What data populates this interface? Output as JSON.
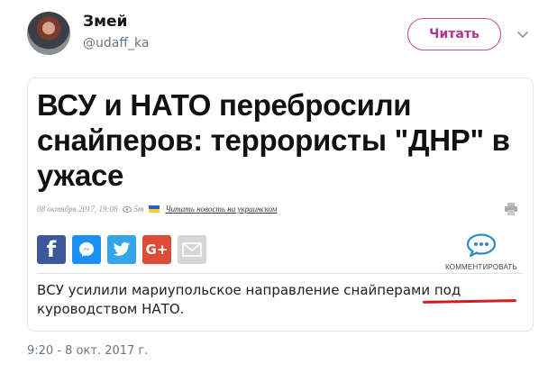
{
  "tweet": {
    "author_name": "Змей",
    "author_handle": "@udaff_ka",
    "follow_label": "Читать",
    "timestamp": "9:20 - 8 окт. 2017 г."
  },
  "article": {
    "headline": "ВСУ и НАТО перебросили снайперов: террористы \"ДНР\" в ужасе",
    "date": "08 октября 2017, 19:08",
    "views": "5т",
    "lang_link": "Читать новость на украинском",
    "comments_label": "КОММЕНТИРОВАТЬ",
    "summary": "ВСУ усилили мариупольское направление снайперами под куроводством НАТО.",
    "share_icons": [
      "facebook-icon",
      "messenger-icon",
      "twitter-icon",
      "google-plus-icon",
      "email-icon"
    ],
    "google_plus_label": "G+",
    "facebook_label": "f"
  },
  "colors": {
    "follow_accent": "#b0368f",
    "facebook": "#3b5998",
    "messenger": "#1c8ff4",
    "twitter": "#35a5e9",
    "google_plus": "#dd4b39",
    "email": "#d6d6d6",
    "underline_mark": "#d21e1e"
  }
}
